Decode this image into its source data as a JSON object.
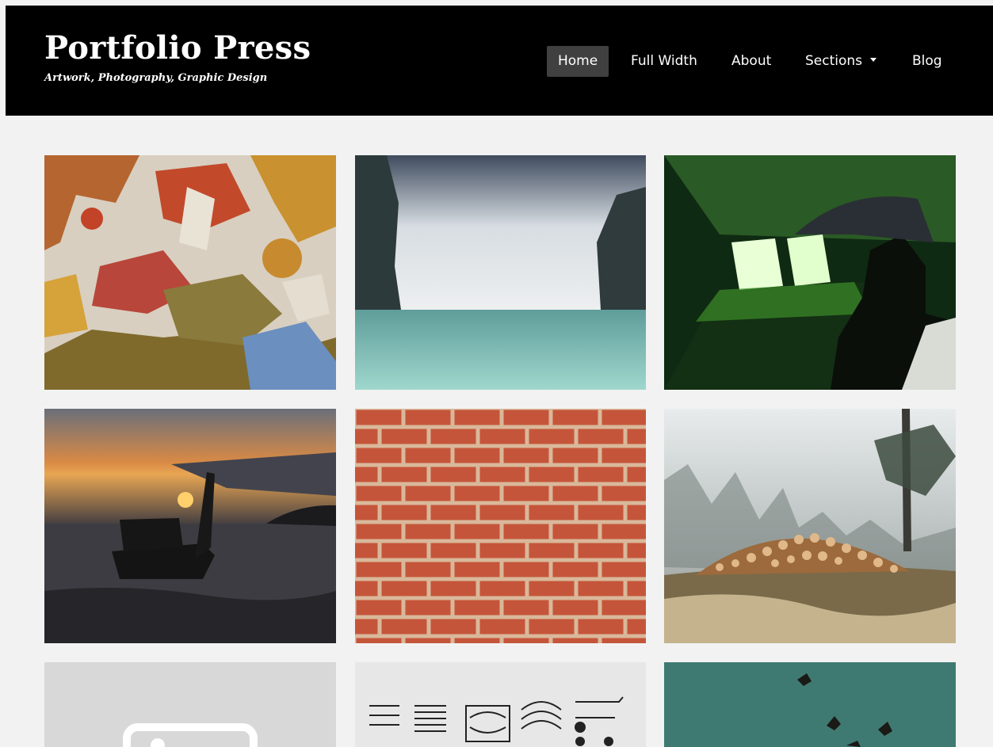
{
  "site": {
    "title": "Portfolio Press",
    "tagline": "Artwork, Photography, Graphic Design"
  },
  "nav": {
    "items": [
      {
        "label": "Home",
        "active": true
      },
      {
        "label": "Full Width",
        "active": false
      },
      {
        "label": "About",
        "active": false
      },
      {
        "label": "Sections",
        "active": false,
        "has_dropdown": true
      },
      {
        "label": "Blog",
        "active": false
      }
    ]
  },
  "portfolio": {
    "tiles": [
      {
        "subject": "peeling-paint-wall"
      },
      {
        "subject": "sea-cliffs"
      },
      {
        "subject": "green-light-room"
      },
      {
        "subject": "longtail-boat-sunset"
      },
      {
        "subject": "brick-wall"
      },
      {
        "subject": "log-pile-forest"
      },
      {
        "subject": "placeholder-image"
      },
      {
        "subject": "ornament-sheet"
      },
      {
        "subject": "birds-flying"
      }
    ]
  },
  "colors": {
    "header_bg": "#000000",
    "page_bg": "#f2f2f2",
    "active_nav_bg": "#404040"
  }
}
